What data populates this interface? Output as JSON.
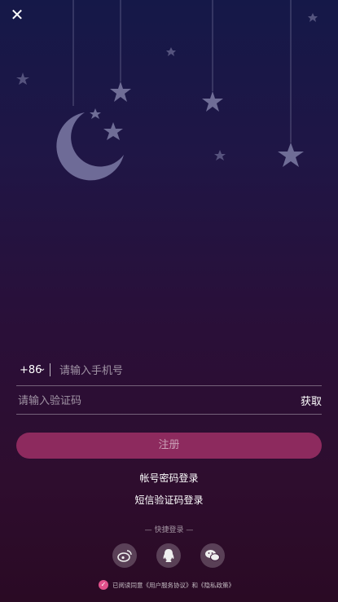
{
  "header": {
    "close_icon": "close-icon"
  },
  "phone": {
    "country_code": "+86",
    "placeholder": "请输入手机号"
  },
  "code": {
    "placeholder": "请输入验证码",
    "get_label": "获取"
  },
  "register_label": "注册",
  "links": {
    "password_login": "帐号密码登录",
    "sms_login": "短信验证码登录"
  },
  "quick_login_label": "— 快捷登录 —",
  "social": [
    {
      "icon": "weibo-icon"
    },
    {
      "icon": "qq-icon"
    },
    {
      "icon": "wechat-icon"
    }
  ],
  "agreement": {
    "text": "已阅读同意《用户服务协议》和《隐私政策》"
  },
  "colors": {
    "accent": "#8d2a5e",
    "check": "#e0508b"
  }
}
